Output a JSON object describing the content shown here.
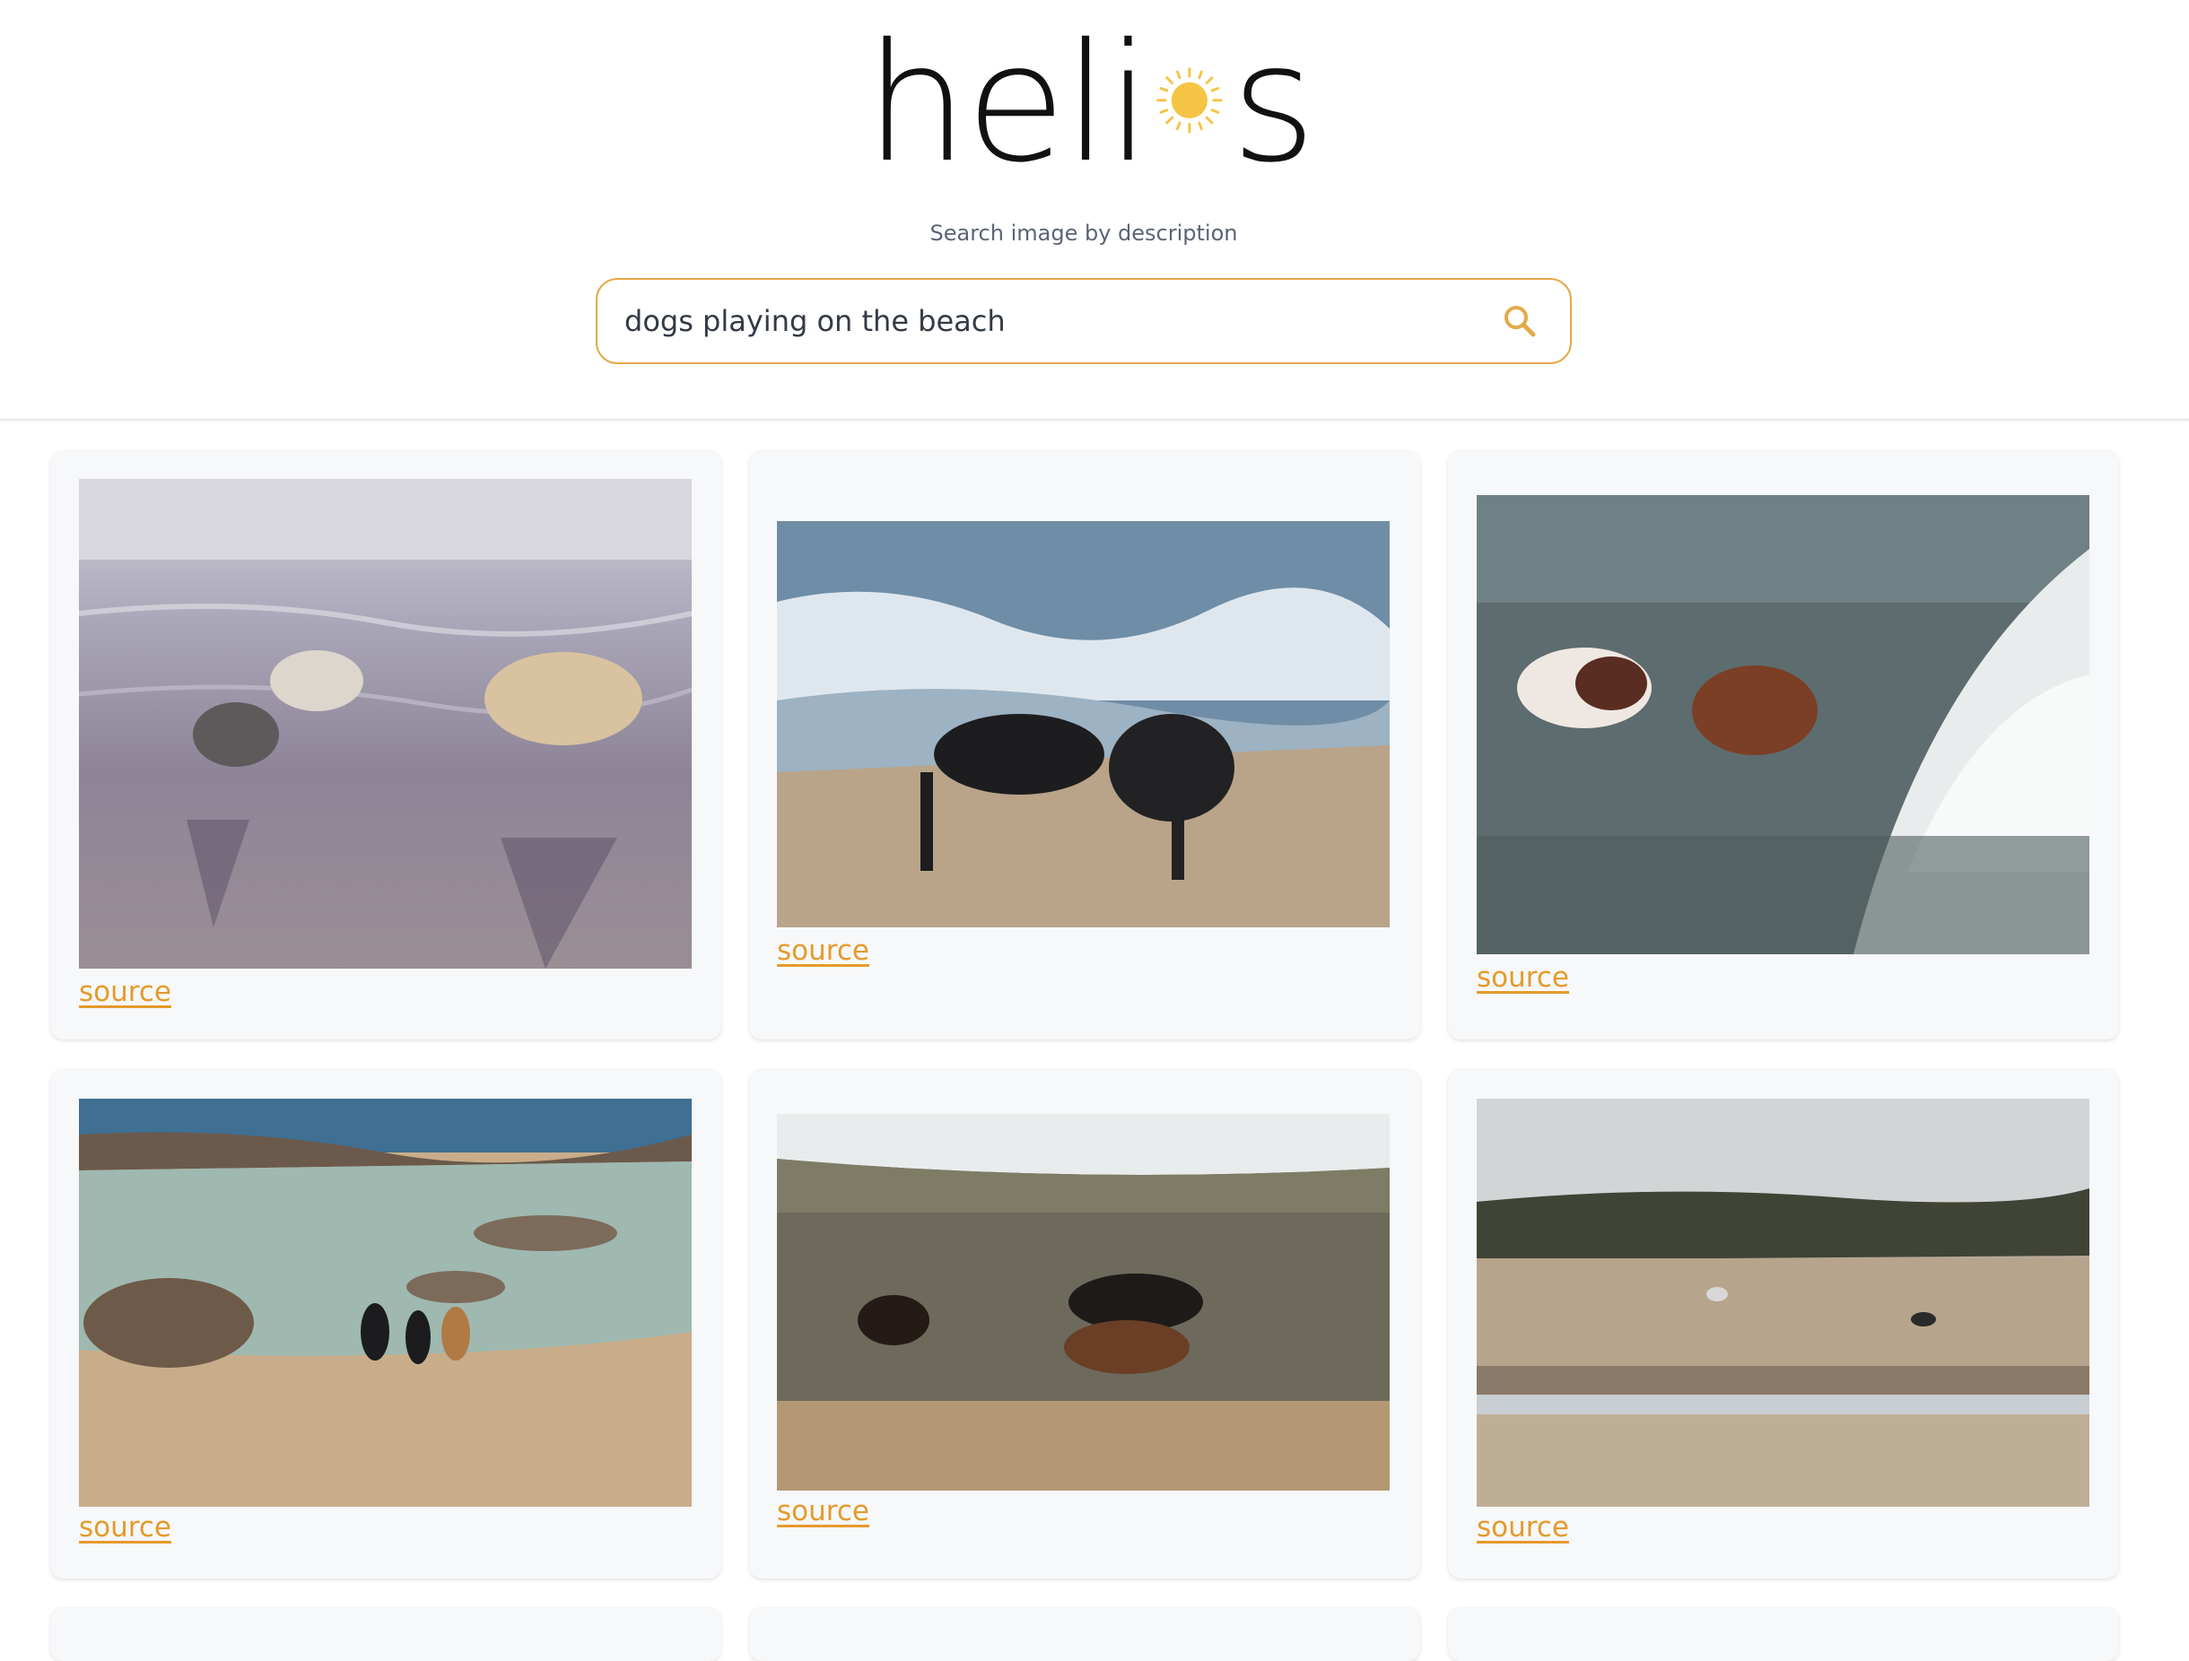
{
  "app": {
    "logo_text_before": "heli",
    "logo_text_after": "s",
    "logo_sun_icon": "sun-icon"
  },
  "header": {
    "subtitle": "Search image by description"
  },
  "search": {
    "value": "dogs playing on the beach",
    "icon": "search-icon",
    "accent_color": "#e4a94a"
  },
  "results": [
    {
      "link_label": "source",
      "alt": ""
    },
    {
      "link_label": "source",
      "alt": ""
    },
    {
      "link_label": "source",
      "alt": ""
    },
    {
      "link_label": "source",
      "alt": ""
    },
    {
      "link_label": "source",
      "alt": ""
    },
    {
      "link_label": "source",
      "alt": ""
    }
  ],
  "colors": {
    "link": "#e59a2b",
    "card_background": "#f7f8fa",
    "sun": "#f6c445"
  }
}
